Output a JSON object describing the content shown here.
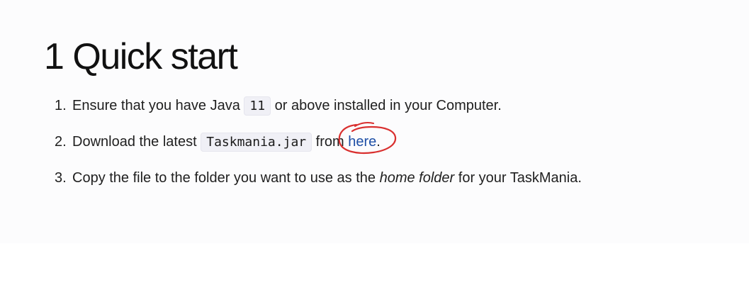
{
  "heading": {
    "number": "1",
    "title": "Quick start"
  },
  "steps": [
    {
      "num": "1.",
      "before": "Ensure that you have Java ",
      "code": "11",
      "after": " or above installed in your Computer."
    },
    {
      "num": "2.",
      "before": "Download the latest ",
      "code": "Taskmania.jar",
      "middle": " from ",
      "link": "here",
      "after": "."
    },
    {
      "num": "3.",
      "before": "Copy the file to the folder you want to use as the ",
      "emphasis": "home folder",
      "after": " for your TaskMania."
    }
  ],
  "annotation": {
    "color": "#d9302f",
    "shape": "hand-drawn circle around link"
  }
}
